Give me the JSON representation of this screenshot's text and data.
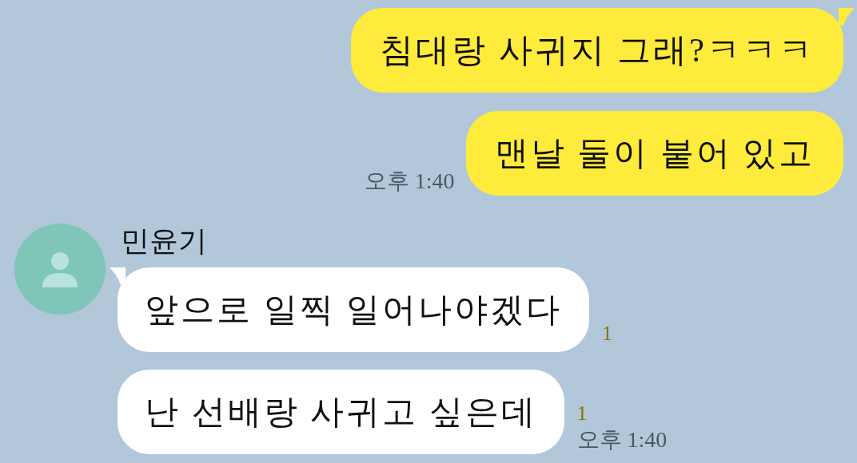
{
  "groups": [
    {
      "kind": "sent",
      "bubbles": [
        {
          "text": "침대랑 사귀지 그래?ㅋㅋㅋ"
        },
        {
          "text": "맨날 둘이 붙어 있고"
        }
      ],
      "time": "오후 1:40"
    },
    {
      "kind": "received",
      "sender": "민윤기",
      "bubbles": [
        {
          "text": "앞으로 일찍 일어나야겠다",
          "unread": "1"
        },
        {
          "text": "난 선배랑 사귀고 싶은데",
          "unread": "1"
        }
      ],
      "time": "오후 1:40"
    }
  ]
}
